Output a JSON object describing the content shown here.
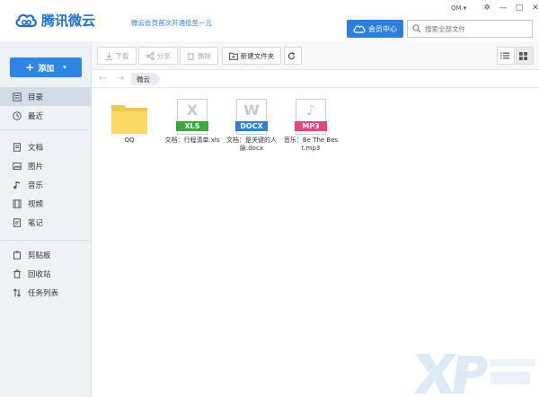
{
  "app": {
    "title": "腾讯微云",
    "promo": "微云会员首次开通低至一元",
    "user": "QM ▾",
    "vip_label": "会员中心",
    "search_placeholder": "搜索全部文件"
  },
  "sidebar": {
    "add_label": "添加",
    "items": [
      {
        "label": "目录",
        "icon": "directory-icon",
        "active": true
      },
      {
        "label": "最近",
        "icon": "clock-icon"
      },
      {
        "label": "文档",
        "icon": "document-icon"
      },
      {
        "label": "图片",
        "icon": "image-icon"
      },
      {
        "label": "音乐",
        "icon": "music-icon"
      },
      {
        "label": "视频",
        "icon": "video-icon"
      },
      {
        "label": "笔记",
        "icon": "note-icon"
      },
      {
        "label": "剪贴板",
        "icon": "clipboard-icon"
      },
      {
        "label": "回收站",
        "icon": "trash-icon"
      },
      {
        "label": "任务列表",
        "icon": "transfer-icon"
      }
    ]
  },
  "toolbar": {
    "download": "下载",
    "share": "分享",
    "delete": "删除",
    "new_folder": "新建文件夹"
  },
  "breadcrumb": {
    "current": "微云"
  },
  "files": [
    {
      "name": "QQ",
      "type": "folder"
    },
    {
      "name": "文档：行程清单.xls",
      "type": "xls",
      "glyph": "X",
      "tag": "XLS",
      "color": "#3aa83a"
    },
    {
      "name": "文档：是关键的人脉.docx",
      "type": "docx",
      "glyph": "W",
      "tag": "DOCX",
      "color": "#2f7fd9"
    },
    {
      "name": "音乐：Be The Best.mp3",
      "type": "mp3",
      "glyph": "♪",
      "tag": "MP3",
      "color": "#e6457a"
    }
  ],
  "colors": {
    "accent": "#2d86e6",
    "sidebar_bg": "#eef2f7"
  }
}
